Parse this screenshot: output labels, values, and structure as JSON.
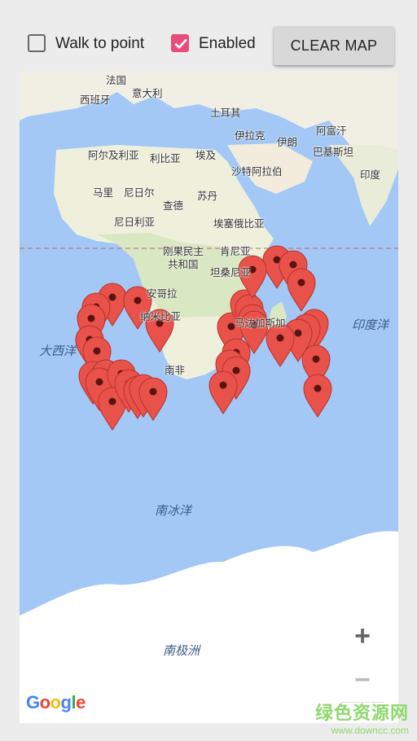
{
  "toolbar": {
    "walk_label": "Walk to point",
    "walk_checked": false,
    "enabled_label": "Enabled",
    "enabled_checked": true,
    "clear_label": "CLEAR MAP"
  },
  "map": {
    "labels": {
      "france": "法国",
      "spain": "西班牙",
      "italy": "意大利",
      "turkey": "土耳其",
      "iraq": "伊拉克",
      "iran": "伊朗",
      "afghanistan": "阿富汗",
      "pakistan": "巴基斯坦",
      "india": "印度",
      "algeria": "阿尔及利亚",
      "libya": "利比亚",
      "egypt": "埃及",
      "saudi": "沙特阿拉伯",
      "mali": "马里",
      "niger": "尼日尔",
      "chad": "查德",
      "sudan": "苏丹",
      "nigeria": "尼日利亚",
      "ethiopia": "埃塞俄比亚",
      "drc_line1": "刚果民主",
      "drc_line2": "共和国",
      "kenya": "肯尼亚",
      "tanzania": "坦桑尼亚",
      "angola": "安哥拉",
      "namibia": "纳米比亚",
      "south_africa": "南非",
      "madagascar": "马达加斯加",
      "atlantic": "大西洋",
      "indian_ocean": "印度洋",
      "southern_ocean": "南冰洋",
      "antarctica": "南极洲"
    },
    "zoom_in": "+",
    "zoom_out": "−",
    "attribution": "Google",
    "marker_color": "#e8524a"
  },
  "watermark": {
    "name": "绿色资源网",
    "url": "www.downcc.com"
  }
}
